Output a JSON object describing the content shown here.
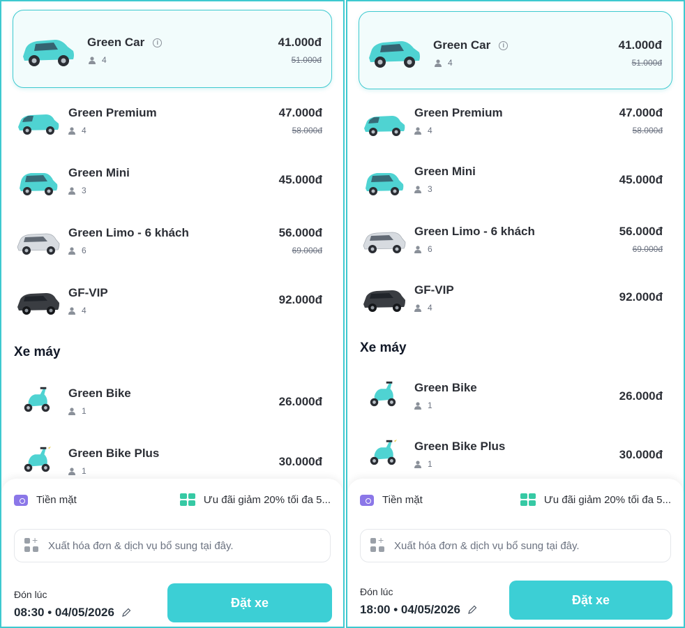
{
  "colors": {
    "accent": "#3ccfd5",
    "border_accent": "#3ec9cf",
    "wallet": "#8b77e8",
    "promo": "#36c9a4",
    "car_teal": "#4fd3d2",
    "car_silver": "#d7dbe0",
    "car_black": "#3a3d42"
  },
  "screens": [
    {
      "cars": [
        {
          "name": "Green Car",
          "seats": "4",
          "price": "41.000đ",
          "old_price": "51.000đ",
          "icon": "car-teal-icon",
          "has_info": true
        },
        {
          "name": "Green Premium",
          "seats": "4",
          "price": "47.000đ",
          "old_price": "58.000đ",
          "icon": "car-teal-icon"
        },
        {
          "name": "Green Mini",
          "seats": "3",
          "price": "45.000đ",
          "old_price": "",
          "icon": "car-teal-mini-icon"
        },
        {
          "name": "Green Limo - 6 khách",
          "seats": "6",
          "price": "56.000đ",
          "old_price": "69.000đ",
          "icon": "car-silver-icon"
        },
        {
          "name": "GF-VIP",
          "seats": "4",
          "price": "92.000đ",
          "old_price": "",
          "icon": "car-black-icon"
        }
      ],
      "moto_section": "Xe máy",
      "motos": [
        {
          "name": "Green Bike",
          "seats": "1",
          "price": "26.000đ",
          "icon": "scooter-icon"
        },
        {
          "name": "Green Bike Plus",
          "seats": "1",
          "price": "30.000đ",
          "icon": "scooter-plus-icon"
        }
      ],
      "payment": "Tiền mặt",
      "promo": "Ưu đãi giảm 20% tối đa 5...",
      "invoice_placeholder": "Xuất hóa đơn & dịch vụ bổ sung tại đây.",
      "pickup_label": "Đón lúc",
      "pickup_time": "08:30 • 04/05/2026",
      "book_label": "Đặt xe"
    },
    {
      "cars": [
        {
          "name": "Green Car",
          "seats": "4",
          "price": "41.000đ",
          "old_price": "51.000đ",
          "icon": "car-teal-icon",
          "has_info": true
        },
        {
          "name": "Green Premium",
          "seats": "4",
          "price": "47.000đ",
          "old_price": "58.000đ",
          "icon": "car-teal-icon"
        },
        {
          "name": "Green Mini",
          "seats": "3",
          "price": "45.000đ",
          "old_price": "",
          "icon": "car-teal-mini-icon"
        },
        {
          "name": "Green Limo - 6 khách",
          "seats": "6",
          "price": "56.000đ",
          "old_price": "69.000đ",
          "icon": "car-silver-icon"
        },
        {
          "name": "GF-VIP",
          "seats": "4",
          "price": "92.000đ",
          "old_price": "",
          "icon": "car-black-icon"
        }
      ],
      "moto_section": "Xe máy",
      "motos": [
        {
          "name": "Green Bike",
          "seats": "1",
          "price": "26.000đ",
          "icon": "scooter-icon"
        },
        {
          "name": "Green Bike Plus",
          "seats": "1",
          "price": "30.000đ",
          "icon": "scooter-plus-icon"
        }
      ],
      "payment": "Tiền mặt",
      "promo": "Ưu đãi giảm 20% tối đa 5...",
      "invoice_placeholder": "Xuất hóa đơn & dịch vụ bổ sung tại đây.",
      "pickup_label": "Đón lúc",
      "pickup_time": "18:00 • 04/05/2026",
      "book_label": "Đặt xe"
    }
  ]
}
